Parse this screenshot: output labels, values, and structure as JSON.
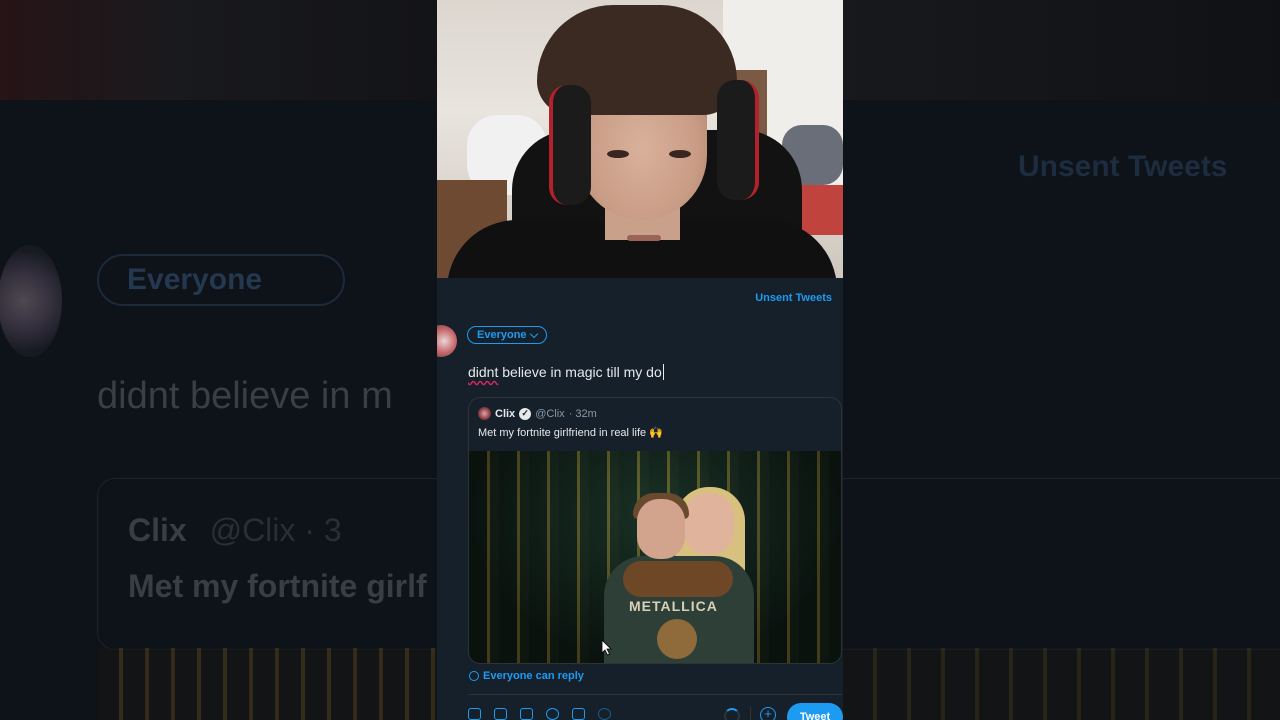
{
  "compose": {
    "unsent_tweets": "Unsent Tweets",
    "audience": "Everyone",
    "text_misspelled": "didnt",
    "text_rest": " believe in magic till my do",
    "reply_setting": "Everyone can reply",
    "tweet_button": "Tweet"
  },
  "quoted_tweet": {
    "name": "Clix",
    "handle": "@Clix",
    "time": "· 32m",
    "body": "Met my fortnite girlfriend in real life 🙌",
    "photo_text": "METALLICA"
  },
  "background": {
    "audience": "Everyone",
    "text": "didnt believe in m",
    "quote_name": "Clix",
    "quote_handle": "@Clix · 3",
    "quote_body": "Met my fortnite girlf",
    "right_title": "Unsent Tweets"
  },
  "colors": {
    "accent": "#1d9bf0",
    "background": "#15202b",
    "text": "#e7e9ea",
    "muted": "#8b98a5"
  }
}
